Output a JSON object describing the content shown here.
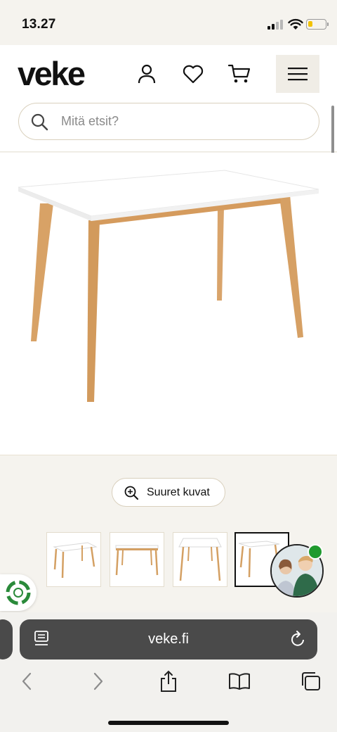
{
  "status_bar": {
    "time": "13.27",
    "battery_level": 0.25,
    "battery_color": "#f2c200"
  },
  "header": {
    "logo": "veke",
    "icons": [
      "account-icon",
      "heart-icon",
      "cart-icon",
      "menu-icon"
    ],
    "search": {
      "placeholder": "Mitä etsit?",
      "value": ""
    }
  },
  "product": {
    "image": "table-photo"
  },
  "gallery": {
    "zoom_button_label": "Suuret kuvat",
    "thumbnails": [
      {
        "view": "table-front-angle",
        "active": false
      },
      {
        "view": "table-side",
        "active": false
      },
      {
        "view": "table-front",
        "active": false
      },
      {
        "view": "table-angle",
        "active": true
      }
    ]
  },
  "chat": {
    "status_color": "#1f9a2e"
  },
  "browser": {
    "url": "veke.fi",
    "nav_icons": [
      "back-icon",
      "forward-icon",
      "share-icon",
      "bookmarks-icon",
      "tabs-icon"
    ]
  }
}
